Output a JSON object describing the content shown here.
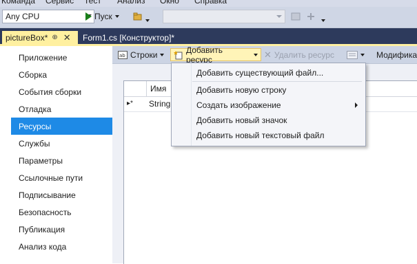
{
  "menubar": {
    "items": [
      "Команда",
      "Сервис",
      "Тест",
      "Анализ",
      "Окно",
      "Справка"
    ]
  },
  "toolbar": {
    "platform_value": "Any CPU",
    "run_label": "Пуск"
  },
  "tabs": {
    "active_label": "pictureBox*",
    "inactive_label": "Form1.cs [Конструктор]*"
  },
  "leftnav": {
    "items": [
      {
        "label": "Приложение"
      },
      {
        "label": "Сборка"
      },
      {
        "label": "События сборки"
      },
      {
        "label": "Отладка"
      },
      {
        "label": "Ресурсы",
        "selected": true
      },
      {
        "label": "Службы"
      },
      {
        "label": "Параметры"
      },
      {
        "label": "Ссылочные пути"
      },
      {
        "label": "Подписывание"
      },
      {
        "label": "Безопасность"
      },
      {
        "label": "Публикация"
      },
      {
        "label": "Анализ кода"
      }
    ]
  },
  "resources_toolbar": {
    "strings_label": "Строки",
    "add_resource_label": "Добавить ресурс",
    "remove_resource_label": "Удалить ресурс",
    "modifier_label": "Модифика"
  },
  "grid": {
    "column_name": "Имя",
    "row_marker": "▸*",
    "row_value": "String"
  },
  "dropdown": {
    "items": [
      {
        "label": "Добавить существующий файл..."
      },
      {
        "label": "Добавить новую строку"
      },
      {
        "label": "Создать изображение",
        "submenu": true
      },
      {
        "label": "Добавить новый значок"
      },
      {
        "label": "Добавить новый текстовый файл"
      }
    ]
  },
  "colors": {
    "selection": "#1e8ae6",
    "tab_active": "#fff0a0",
    "tab_strip": "#2d3a5c"
  }
}
